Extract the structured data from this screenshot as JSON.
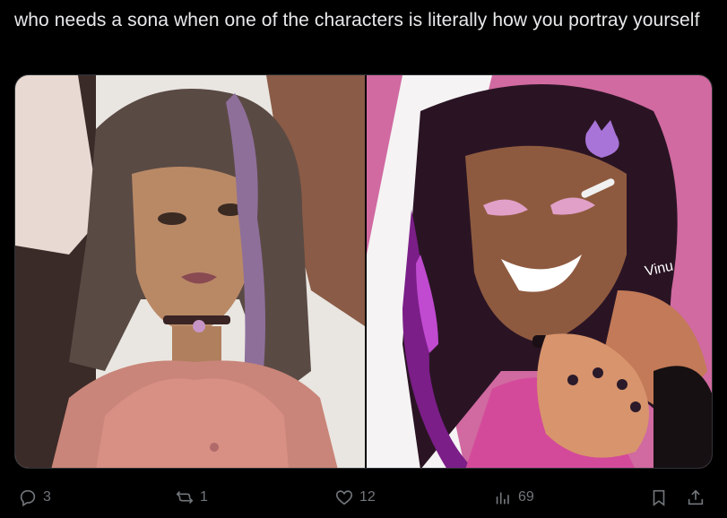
{
  "post": {
    "text": "who needs a sona when one of the characters is literally how you portray yourself"
  },
  "media": {
    "left_image": {
      "alt": ""
    },
    "right_image": {
      "alt": "",
      "signature": "Vinu"
    }
  },
  "actions": {
    "reply_count": "3",
    "retweet_count": "1",
    "like_count": "12",
    "views_count": "69"
  },
  "icons": [
    "reply-icon",
    "retweet-icon",
    "like-icon",
    "views-icon",
    "bookmark-icon",
    "share-icon"
  ],
  "colors": {
    "background": "#000000",
    "text": "#e7e9ea",
    "muted": "#71767b",
    "pink_bg": "#d06aa0"
  }
}
